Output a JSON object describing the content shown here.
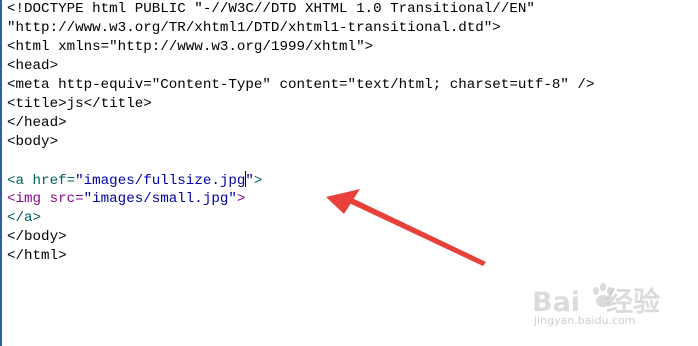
{
  "editor": {
    "lines": [
      [
        {
          "text": "<!DOCTYPE html PUBLIC \"-//W3C//DTD XHTML 1.0 Transitional//EN\"",
          "color": "black"
        }
      ],
      [
        {
          "text": "\"http://www.w3.org/TR/xhtml1/DTD/xhtml1-transitional.dtd\">",
          "color": "black"
        }
      ],
      [
        {
          "text": "<html xmlns=\"http://www.w3.org/1999/xhtml\">",
          "color": "black"
        }
      ],
      [
        {
          "text": "<head>",
          "color": "black"
        }
      ],
      [
        {
          "text": "<meta http-equiv=\"Content-Type\" content=\"text/html; charset=utf-8\" />",
          "color": "black"
        }
      ],
      [
        {
          "text": "<title>js</title>",
          "color": "black"
        }
      ],
      [
        {
          "text": "</head>",
          "color": "black"
        }
      ],
      [
        {
          "text": "<body>",
          "color": "black"
        }
      ],
      [],
      [
        {
          "text": "<a href=",
          "color": "dkgreen"
        },
        {
          "text": "\"images/fullsize.jpg\"",
          "color": "blue",
          "caret_before_last": true
        },
        {
          "text": ">",
          "color": "dkgreen"
        }
      ],
      [
        {
          "text": "<img src=",
          "color": "purple"
        },
        {
          "text": "\"images/small.jpg\"",
          "color": "blue"
        },
        {
          "text": ">",
          "color": "purple"
        }
      ],
      [
        {
          "text": "</a>",
          "color": "dkgreen"
        }
      ],
      [
        {
          "text": "</body>",
          "color": "black"
        }
      ],
      [
        {
          "text": "</html>",
          "color": "black"
        }
      ]
    ]
  },
  "watermark": {
    "brand_left": "Bai",
    "brand_right": "经验",
    "url": "jingyan.baidu.com"
  },
  "colors": {
    "arrow": "#e8403b",
    "black": "#000000",
    "blue": "#0000a8",
    "purple": "#8b0a8b",
    "dkgreen": "#006060",
    "gutter": "#2f5fa8"
  }
}
